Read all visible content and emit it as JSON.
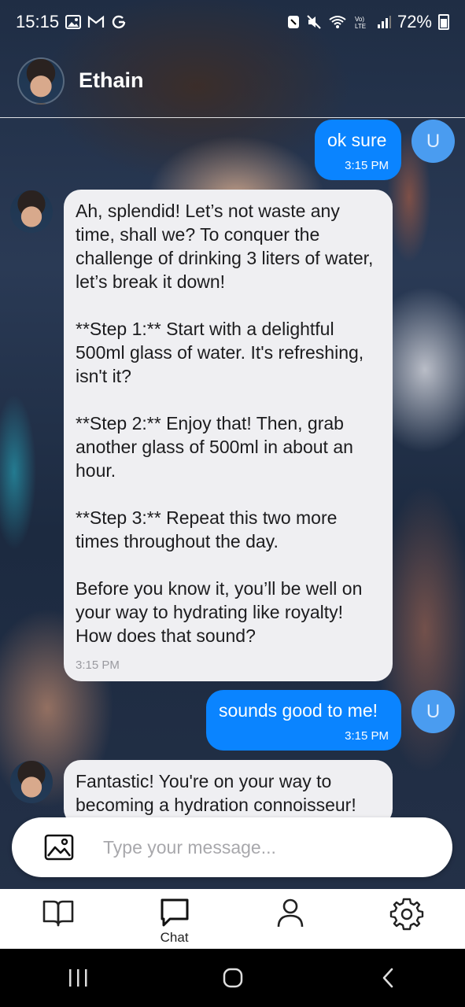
{
  "status_bar": {
    "time": "15:15",
    "left_icons": [
      "image-icon",
      "gmail-icon",
      "google-icon"
    ],
    "right_icons": [
      "nfc-icon",
      "mute-icon",
      "wifi-icon",
      "volte-icon",
      "signal-icon",
      "battery-icon"
    ],
    "battery": "72%"
  },
  "header": {
    "name": "Ethain",
    "avatar": "character-avatar"
  },
  "messages": [
    {
      "sender": "user",
      "text": "ok sure",
      "time": "3:15 PM"
    },
    {
      "sender": "bot",
      "text": "Ah, splendid! Let’s not waste any time, shall we? To conquer the challenge of drinking 3 liters of water, let’s break it down!\n\n**Step 1:** Start with a delightful 500ml glass of water. It's refreshing, isn't it?\n\n**Step 2:** Enjoy that! Then, grab another glass of 500ml in about an hour.\n\n**Step 3:** Repeat this two more times throughout the day.\n\nBefore you know it, you’ll be well on your way to hydrating like royalty! How does that sound?",
      "time": "3:15 PM"
    },
    {
      "sender": "user",
      "text": "sounds good to me!",
      "time": "3:15 PM"
    },
    {
      "sender": "bot",
      "text": "Fantastic! You're on your way to becoming a hydration connoisseur!",
      "time": ""
    }
  ],
  "user_avatar_letter": "U",
  "composer": {
    "placeholder": "Type your message...",
    "value": "",
    "attach_icon": "image-icon"
  },
  "nav": {
    "items": [
      {
        "icon": "book-icon",
        "label": ""
      },
      {
        "icon": "chat-icon",
        "label": "Chat"
      },
      {
        "icon": "profile-icon",
        "label": ""
      },
      {
        "icon": "gear-icon",
        "label": ""
      }
    ],
    "active_index": 1
  },
  "colors": {
    "user_bubble": "#0a84ff",
    "bot_bubble": "#efeff2",
    "user_avatar": "#4a9cf0"
  }
}
